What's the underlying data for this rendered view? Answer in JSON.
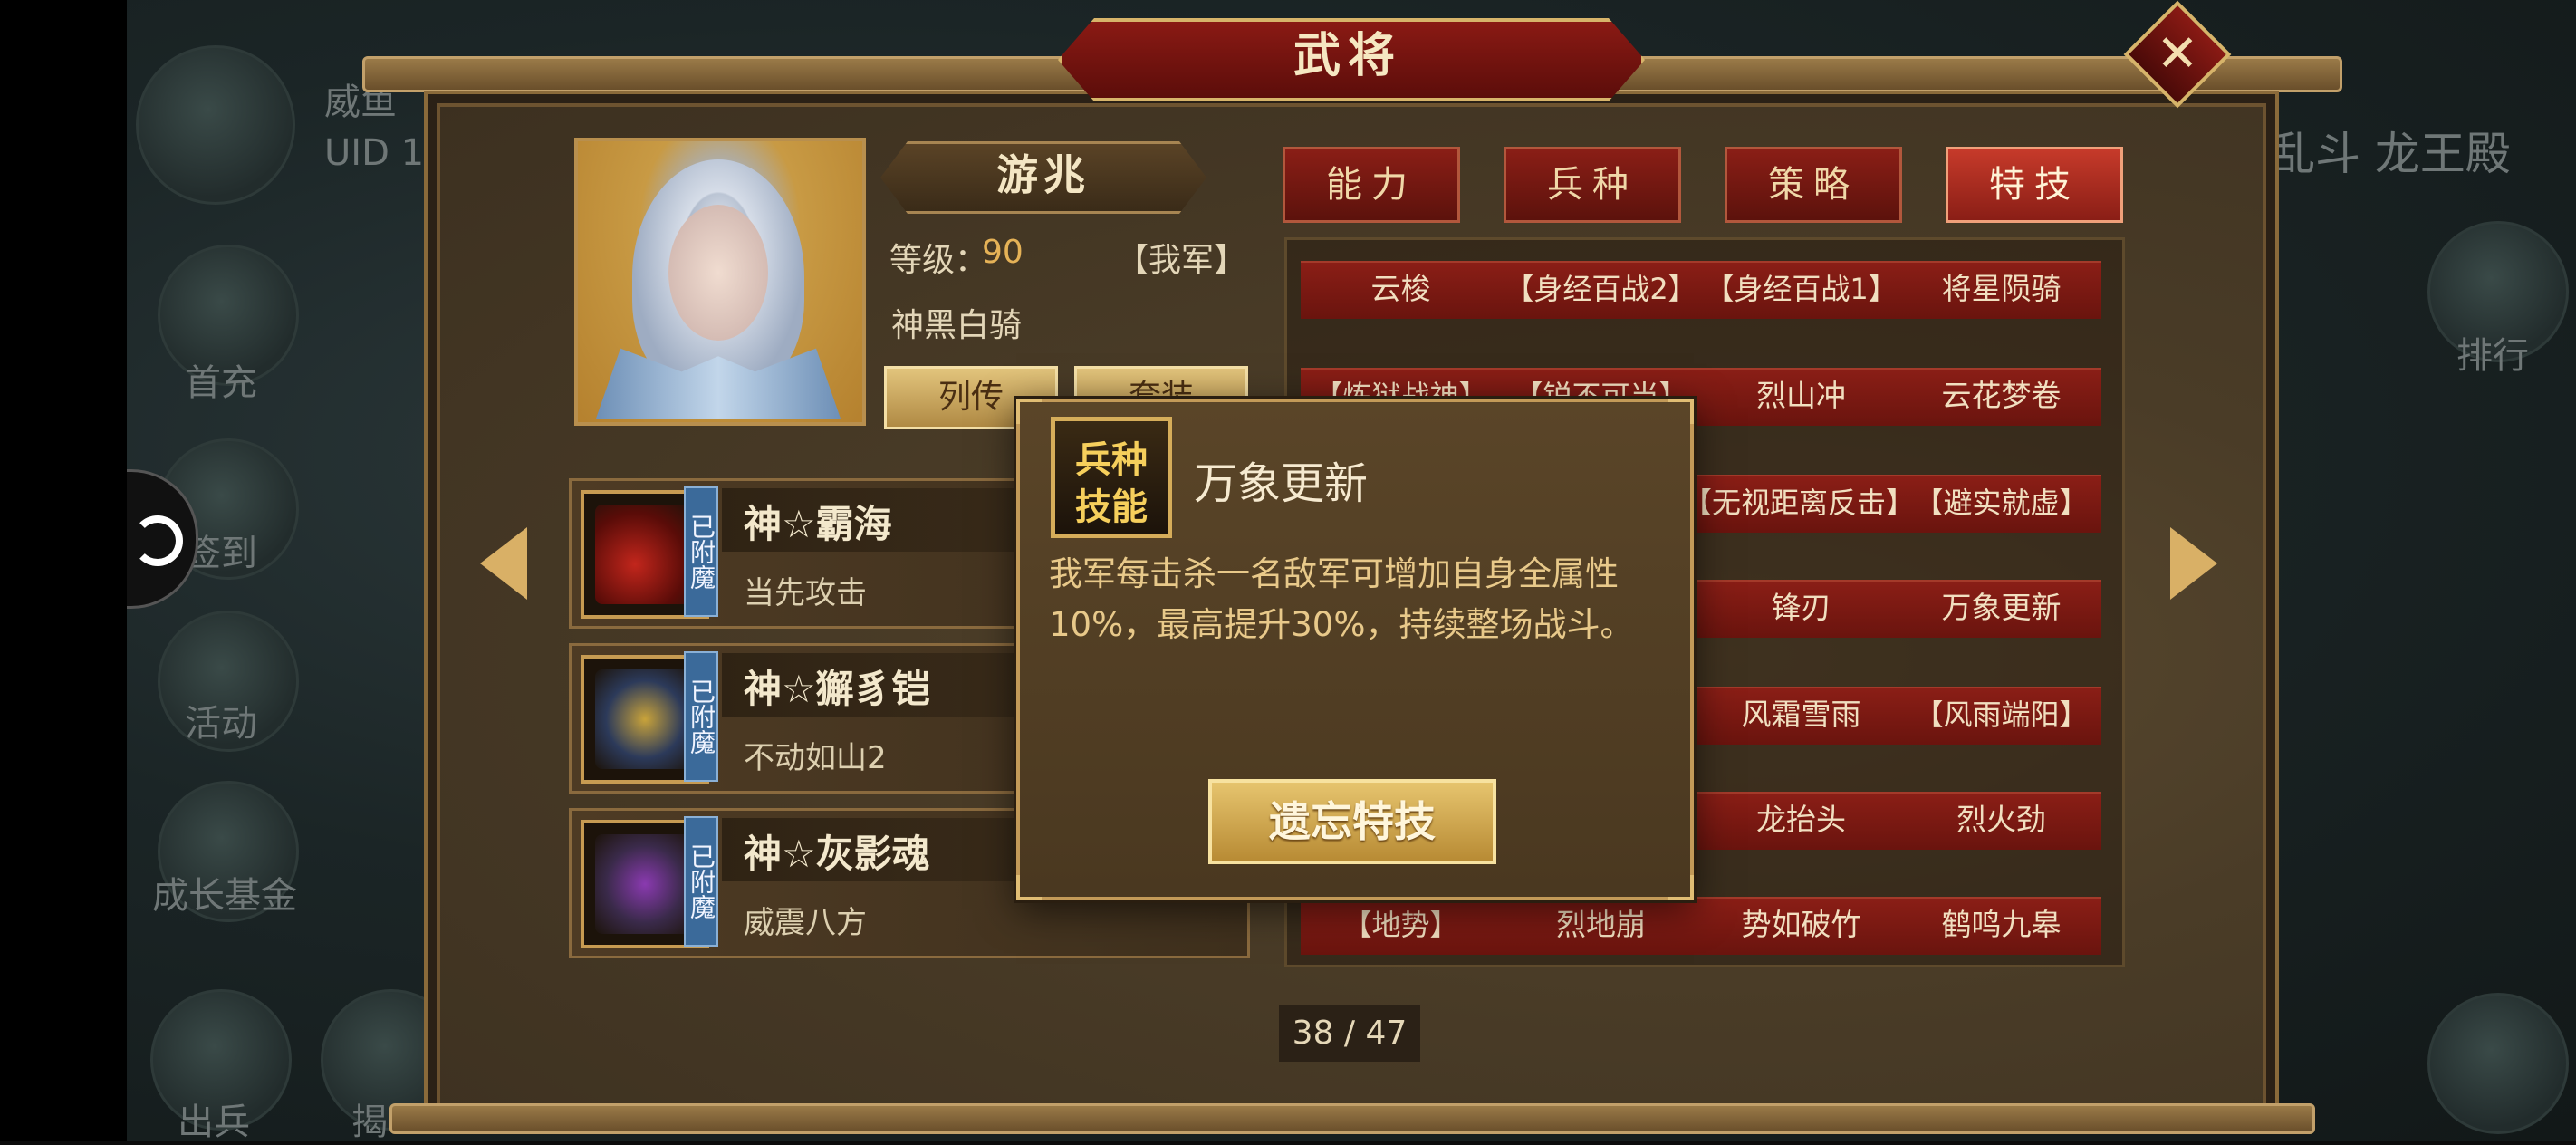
{
  "background": {
    "player_name_partial": "威鱼",
    "uid_partial": "UID 1",
    "menu_items": [
      "首充",
      "签到",
      "活动",
      "成长基金",
      "出兵",
      "揭"
    ],
    "top_right_text": "乱斗 龙王殿",
    "right_menu": "排行"
  },
  "window": {
    "title": "武将",
    "close_label": "✕"
  },
  "hero": {
    "name": "游兆",
    "level_label": "等级：",
    "level_value": "90",
    "faction": "【我军】",
    "troop_type": "神黑白骑",
    "buttons": {
      "biography": "列传",
      "outfit": "套装"
    }
  },
  "equipment": [
    {
      "tag": "已附魔",
      "name": "神☆霸海",
      "effect": "当先攻击"
    },
    {
      "tag": "已附魔",
      "name": "神☆獬豸铠",
      "effect": "不动如山2"
    },
    {
      "tag": "已附魔",
      "name": "神☆灰影魂",
      "effect": "威震八方"
    }
  ],
  "tabs": [
    {
      "label": "能力",
      "active": false
    },
    {
      "label": "兵种",
      "active": false
    },
    {
      "label": "策略",
      "active": false
    },
    {
      "label": "特技",
      "active": true
    }
  ],
  "skills": [
    [
      "云梭",
      "【身经百战2】",
      "【身经百战1】",
      "将星陨骑"
    ],
    [
      "【炼狱战神】",
      "【锐不可当】",
      "烈山冲",
      "云花梦卷"
    ],
    [
      "",
      "",
      "【无视距离反击】",
      "【避实就虚】"
    ],
    [
      "",
      "",
      "锋刃",
      "万象更新"
    ],
    [
      "",
      "",
      "风霜雪雨",
      "【风雨端阳】"
    ],
    [
      "",
      "",
      "龙抬头",
      "烈火劲"
    ],
    [
      "【地势】",
      "烈地崩",
      "势如破竹",
      "鹤鸣九皋"
    ]
  ],
  "page": {
    "current": "38",
    "total": "47",
    "label": "38 / 47"
  },
  "popup": {
    "icon_line1": "兵种",
    "icon_line2": "技能",
    "title": "万象更新",
    "description": "我军每击杀一名敌军可增加自身全属性10%，最高提升30%，持续整场战斗。",
    "button": "遗忘特技"
  },
  "colors": {
    "panel": "#4a3c27",
    "tab_red": "#8a1e16",
    "tab_active": "#c63a2a",
    "gold_text": "#e5b257",
    "button_gold": "#e2c47c",
    "enchant_tag": "#3b6a9a"
  }
}
